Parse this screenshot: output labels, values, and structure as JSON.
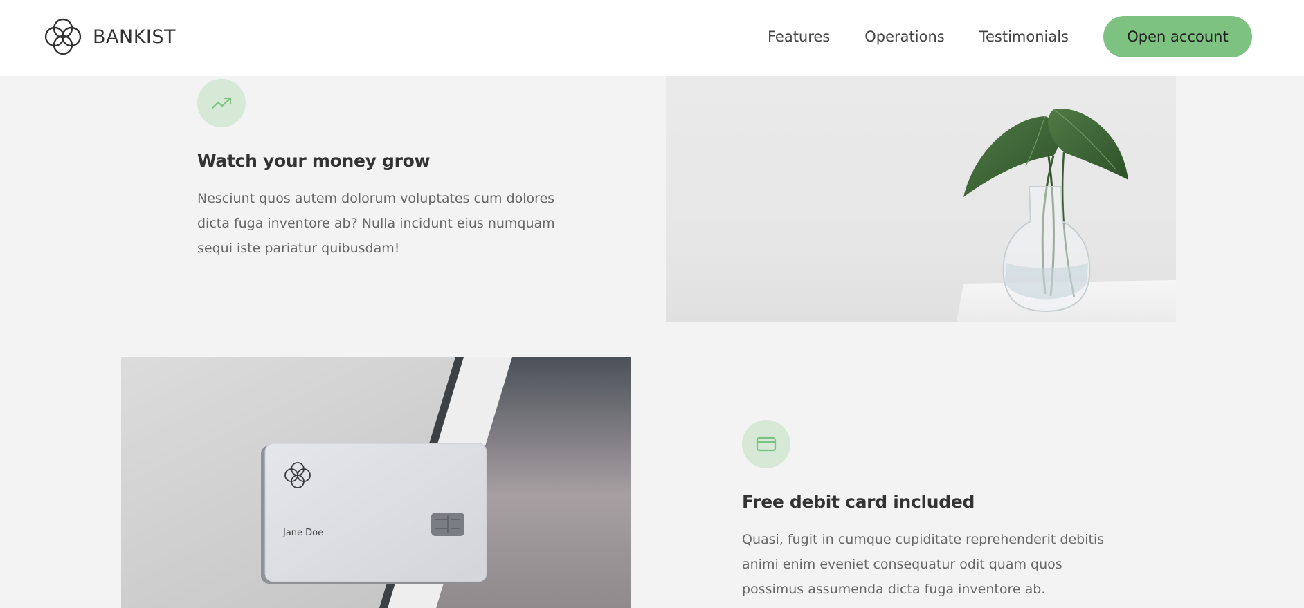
{
  "nav": {
    "brand": "BANKIST",
    "links": [
      "Features",
      "Operations",
      "Testimonials"
    ],
    "cta": "Open account"
  },
  "features": [
    {
      "icon": "trending-up-icon",
      "title": "Watch your money grow",
      "description": "Nesciunt quos autem dolorum voluptates cum dolores dicta fuga inventore ab? Nulla incidunt eius numquam sequi iste pariatur quibusdam!"
    },
    {
      "icon": "credit-card-icon",
      "title": "Free debit card included",
      "description": "Quasi, fugit in cumque cupiditate reprehenderit debitis animi enim eveniet consequatur odit quam quos possimus assumenda dicta fuga inventore ab."
    }
  ],
  "card": {
    "holder": "Jane Doe"
  },
  "colors": {
    "accent": "#7dc281",
    "icon_bg": "#d5e9d6",
    "page_bg": "#f3f3f3"
  }
}
